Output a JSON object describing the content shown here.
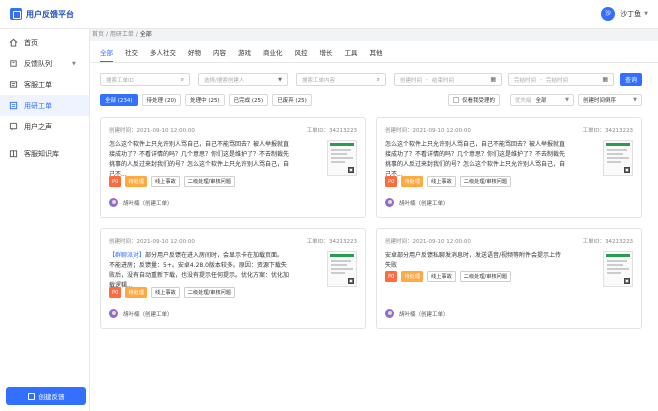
{
  "app": {
    "title": "用户反馈平台"
  },
  "user": {
    "avatar_text": "沙",
    "name": "沙丁鱼"
  },
  "sidebar": {
    "items": [
      {
        "label": "首页",
        "icon": "home-icon",
        "active": false
      },
      {
        "label": "反馈队列",
        "icon": "queue-icon",
        "active": false,
        "has_chevron": true
      },
      {
        "label": "客服工单",
        "icon": "ticket-icon",
        "active": false
      },
      {
        "label": "用研工单",
        "icon": "research-icon",
        "active": true
      },
      {
        "label": "用户之声",
        "icon": "voice-icon",
        "active": false
      },
      {
        "label": "客服知识库",
        "icon": "book-icon",
        "active": false
      }
    ],
    "create_button": "创建反馈"
  },
  "breadcrumb": {
    "home": "首页",
    "section": "用研工单",
    "current": "全部"
  },
  "categories": [
    "全部",
    "社交",
    "多人社交",
    "好物",
    "内容",
    "游戏",
    "商业化",
    "风控",
    "增长",
    "工具",
    "其他"
  ],
  "filters": {
    "ticket_id_placeholder": "搜索工单ID",
    "creator_placeholder": "选择/搜索创建人",
    "content_placeholder": "搜索工单内容",
    "create_start": "创建时间",
    "create_end": "结束时间",
    "done_start": "完结时间",
    "done_end": "完结时间",
    "query_button": "查询"
  },
  "status_tabs": [
    "全部 (234)",
    "待处理 (20)",
    "处理中 (25)",
    "已完成 (25)",
    "已废弃 (25)"
  ],
  "only_mine": "仅看我受理的",
  "priority": {
    "label": "优先级",
    "value": "全部"
  },
  "sort": {
    "value": "创建时间倒序"
  },
  "colors": {
    "accent": "#3370ff",
    "p0": "#ff6b3d",
    "pending": "#ffa940"
  },
  "cards": [
    {
      "created": "创建时间：2021-09-10 12:00:00",
      "ticket_id": "工单ID：34213223",
      "highlight": "",
      "text": "怎么这个软件上只允许别人骂自己，自己不能骂回去？被人举报就直接成功了？不看详情的吗？几个意思？你们这是维护了？不去制裁先挑事的人反过来封我们的号？怎么这个软件上只允许别人骂自己，自己不...",
      "tags": [
        "P0",
        "待处理",
        "线上事故",
        "二级处理/审核问题"
      ],
      "creator": "胡叶楠（创建工单）"
    },
    {
      "created": "创建时间：2021-09-10 12:00:00",
      "ticket_id": "工单ID：34213223",
      "highlight": "",
      "text": "怎么这个软件上只允许别人骂自己，自己不能骂回去？被人举报就直接成功了？不看详情的吗？几个意思？你们这是维护了？不去制裁先挑事的人反过来封我们的号？怎么这个软件上只允许别人骂自己，自己不...",
      "tags": [
        "P0",
        "待处理",
        "线上事故",
        "二级处理/审核问题"
      ],
      "creator": "胡叶楠（创建工单）"
    },
    {
      "created": "创建时间：2021-09-10 12:00:00",
      "ticket_id": "工单ID：34213223",
      "highlight": "【群聊派对】",
      "text": "部分用户反馈在进入房间时，会显示卡在加载页面。不能进房；反馈量：5+。安卓4.28.0版本较多。原因：资源下载失败后，没有自动重新下载，也没有提示任何提示。优化方案：优化加载逻辑...",
      "tags": [
        "P0",
        "待处理",
        "线上事故",
        "二级处理/审核问题"
      ],
      "creator": "胡叶楠（创建工单）"
    },
    {
      "created": "创建时间：2021-09-10 12:00:00",
      "ticket_id": "工单ID：34213223",
      "highlight": "",
      "text": "安卓部分用户反馈私聊发消息时，发送语音/视频等附件会提示上传失败",
      "tags": [
        "P0",
        "待处理",
        "线上事故",
        "二级处理/审核问题"
      ],
      "creator": "胡叶楠（创建工单）"
    }
  ]
}
